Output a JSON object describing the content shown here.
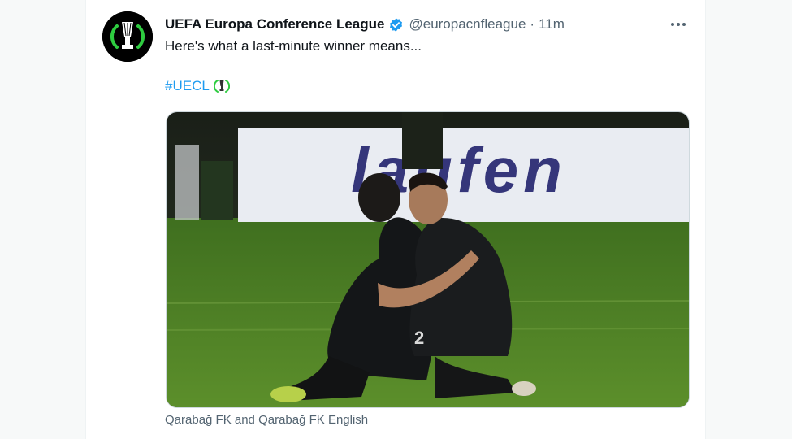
{
  "tweet": {
    "display_name": "UEFA Europa Conference League",
    "handle": "@europacnfleague",
    "separator": "·",
    "time": "11m",
    "text": "Here's what a last-minute winner means...",
    "hashtag": "#UECL",
    "media_caption": "Qarabağ FK and Qarabağ FK English",
    "media_banner_text": "laufen"
  },
  "colors": {
    "accent": "#1d9bf0",
    "text": "#0f1419",
    "secondary": "#536471",
    "brand_green": "#2ecc40"
  },
  "icons": {
    "verified": "verified-badge-icon",
    "more": "more-options-icon",
    "hashtag_emoji": "uecl-trophy-icon"
  }
}
